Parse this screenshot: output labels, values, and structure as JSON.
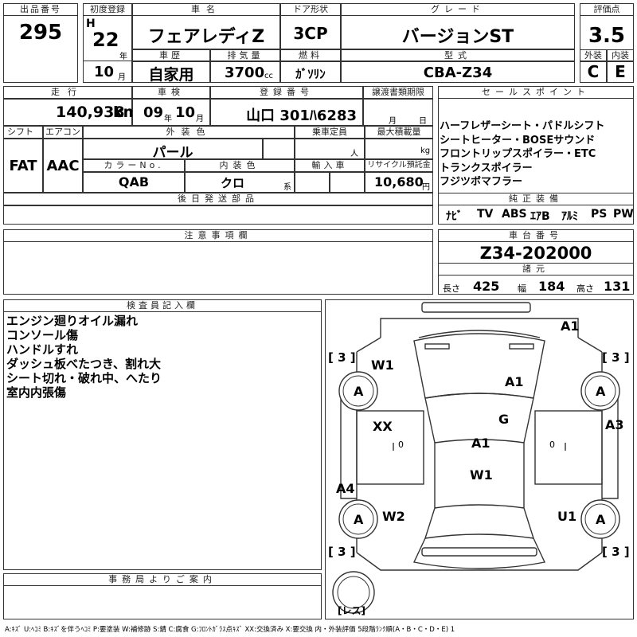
{
  "header": {
    "lot_no_label": "出品番号",
    "lot_no": "295",
    "first_reg_label": "初度登録",
    "era": "H",
    "year": "22",
    "year_unit": "年",
    "month": "10",
    "month_unit": "月",
    "car_name_label": "車名",
    "car_name": "フェアレディZ",
    "door_label": "ドア形状",
    "door": "3CP",
    "grade_label": "グレード",
    "grade": "バージョンST",
    "score_label": "評価点",
    "score": "3.5",
    "exterior_label": "外装",
    "exterior": "C",
    "interior_label": "内装",
    "interior": "E",
    "history_label": "車歴",
    "history": "自家用",
    "displacement_label": "排気量",
    "displacement": "3700",
    "displacement_unit": "cc",
    "fuel_label": "燃料",
    "fuel": "ｶﾞｿﾘﾝ",
    "model_label": "型式",
    "model": "CBA-Z34"
  },
  "row2": {
    "mileage_label": "走行",
    "mileage": "140,938",
    "mileage_unit": "km",
    "inspection_label": "車検",
    "insp_year": "09",
    "insp_year_unit": "年",
    "insp_month": "10",
    "insp_month_unit": "月",
    "reg_no_label": "登録番号",
    "reg_no": "山口 301ﾊ6283",
    "transfer_label": "譲渡書類期限",
    "transfer_month_unit": "月",
    "transfer_day_unit": "日",
    "shift_label": "シフト",
    "shift": "FAT",
    "ac_label": "エアコン",
    "ac": "AAC",
    "color_label": "外装色",
    "color": "パール",
    "capacity_label": "乗車定員",
    "capacity_unit": "人",
    "maxload_label": "最大積載量",
    "maxload_unit": "kg",
    "color_no_label": "カラーNo.",
    "color_no": "QAB",
    "int_color_label": "内装色",
    "int_color": "クロ",
    "int_color_unit": "系",
    "import_label": "輸入車",
    "recycle_label": "リサイクル預託金",
    "recycle": "10,680",
    "recycle_unit": "円",
    "later_parts_label": "後日発送部品",
    "notes_label": "注意事項欄"
  },
  "sales": {
    "label": "セールスポイント",
    "lines": [
      "ハーフレザーシート・パドルシフト",
      "シートヒーター・BOSEサウンド",
      "フロントリップスポイラー・ETC",
      "トランクスポイラー",
      "フジツボマフラー"
    ],
    "equip_label": "純正装備",
    "equip": [
      "ﾅﾋﾞ",
      "TV",
      "ABS",
      "ｴｱB",
      "ｱﾙﾐ",
      "PS",
      "PW"
    ]
  },
  "chassis": {
    "label": "車台番号",
    "number": "Z34-202000",
    "dims_label": "諸元",
    "length_label": "長さ",
    "length": "425",
    "width_label": "幅",
    "width": "184",
    "height_label": "高さ",
    "height": "131"
  },
  "inspector": {
    "label": "検査員記入欄",
    "lines": [
      "エンジン廻りオイル漏れ",
      "コンソール傷",
      "ハンドルすれ",
      "ダッシュ板べたつき、割れ大",
      "シート切れ・破れ中、へたり",
      "室内内張傷"
    ]
  },
  "office": {
    "label": "事務局よりご案内"
  },
  "diagram": {
    "tire_bracket": "[ 3 ]",
    "tire": "A",
    "spare": "[レス]",
    "zero": "0",
    "marks": {
      "front_bumper": "A1",
      "hood": "A1",
      "left_front_fender": "W1",
      "left_front_door": "XX",
      "roof": "A1",
      "right_front_door": "G",
      "right_rear_door": "A3",
      "left_rear_door": "A4",
      "trunk": "W1",
      "left_rear_fender": "W2",
      "right_rear_fender": "U1"
    }
  },
  "legend": "A:ｷｽﾞ U:ﾍｺﾐ B:ｷｽﾞを伴うﾍｺﾐ P:要塗装 W:補修跡 S:錆 C:腐食 G:ﾌﾛﾝﾄｶﾞﾗｽ点ｷｽﾞ XX:交換済み X:要交換 内・外装評価 5段階ﾗﾝｸ順(A・B・C・D・E) 1"
}
